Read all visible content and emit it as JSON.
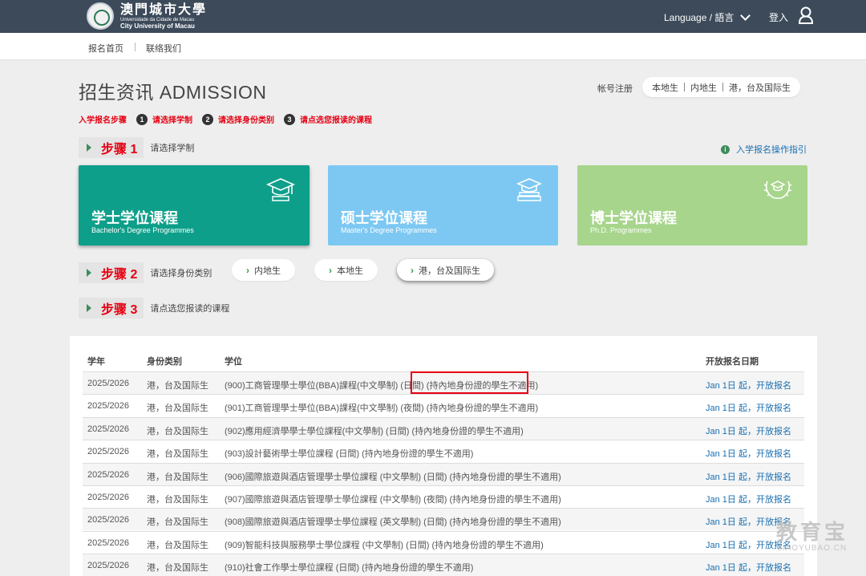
{
  "header": {
    "logo_cn": "澳門城市大學",
    "logo_pt": "Universidade da Cidade de Macau",
    "logo_en": "City University of Macau",
    "language_label": "Language / 語言",
    "login_label": "登入"
  },
  "subnav": {
    "home": "报名首页",
    "contact": "联络我们"
  },
  "page": {
    "title": "招生资讯 ADMISSION",
    "account_register": "帐号注册",
    "register_options": [
      "本地生",
      "内地生",
      "港，台及国际生"
    ]
  },
  "flow": {
    "label": "入学报名步骤",
    "steps": [
      {
        "num": "1",
        "text": "请选择学制"
      },
      {
        "num": "2",
        "text": "请选择身份类别"
      },
      {
        "num": "3",
        "text": "请点选您报读的课程"
      }
    ]
  },
  "step1": {
    "tag": "步骤 1",
    "desc": "请选择学制",
    "guide": "入学报名操作指引"
  },
  "programmes": [
    {
      "cn": "学士学位课程",
      "en": "Bachelor's Degree Programmes",
      "icon": "graduation-cap-icon",
      "color": "#0e9f8a"
    },
    {
      "cn": "硕士学位课程",
      "en": "Master's Degree Programmes",
      "icon": "books-icon",
      "color": "#7dc8f2"
    },
    {
      "cn": "博士学位课程",
      "en": "Ph.D. Programmes",
      "icon": "laurel-cap-icon",
      "color": "#a7d58c"
    }
  ],
  "step2": {
    "tag": "步骤 2",
    "desc": "请选择身份类别",
    "options": [
      "内地生",
      "本地生",
      "港，台及国际生"
    ],
    "selected": "港，台及国际生"
  },
  "step3": {
    "tag": "步骤 3",
    "desc": "请点选您报读的课程"
  },
  "table": {
    "headers": {
      "year": "学年",
      "identity": "身份类别",
      "programme": "学位",
      "date": "开放报名日期"
    },
    "rows": [
      {
        "year": "2025/2026",
        "identity": "港，台及国际生",
        "programme": "(900)工商管理學士學位(BBA)課程(中文學制) (日間) (持內地身份證的學生不適用)",
        "date": "Jan 1日 起，开放报名"
      },
      {
        "year": "2025/2026",
        "identity": "港，台及国际生",
        "programme": "(901)工商管理學士學位(BBA)課程(中文學制) (夜間) (持內地身份證的學生不適用)",
        "date": "Jan 1日 起，开放报名"
      },
      {
        "year": "2025/2026",
        "identity": "港，台及国际生",
        "programme": "(902)應用經濟學學士學位課程(中文學制) (日間) (持內地身份證的學生不適用)",
        "date": "Jan 1日 起，开放报名"
      },
      {
        "year": "2025/2026",
        "identity": "港，台及国际生",
        "programme": "(903)設計藝術學士學位課程 (日間) (持內地身份證的學生不適用)",
        "date": "Jan 1日 起，开放报名"
      },
      {
        "year": "2025/2026",
        "identity": "港，台及国际生",
        "programme": "(906)國際旅遊與酒店管理學士學位課程 (中文學制) (日間) (持內地身份證的學生不適用)",
        "date": "Jan 1日 起，开放报名"
      },
      {
        "year": "2025/2026",
        "identity": "港，台及国际生",
        "programme": "(907)國際旅遊與酒店管理學士學位課程 (中文學制) (夜間) (持內地身份證的學生不適用)",
        "date": "Jan 1日 起，开放报名"
      },
      {
        "year": "2025/2026",
        "identity": "港，台及国际生",
        "programme": "(908)國際旅遊與酒店管理學士學位課程 (英文學制) (日間) (持內地身份證的學生不適用)",
        "date": "Jan 1日 起，开放报名"
      },
      {
        "year": "2025/2026",
        "identity": "港，台及国际生",
        "programme": "(909)智能科技與服務學士學位課程 (中文學制) (日間) (持內地身份證的學生不適用)",
        "date": "Jan 1日 起，开放报名"
      },
      {
        "year": "2025/2026",
        "identity": "港，台及国际生",
        "programme": "(910)社會工作學士學位課程 (日間) (持內地身份證的學生不適用)",
        "date": "Jan 1日 起，开放报名"
      }
    ]
  },
  "watermark": {
    "cn": "教育宝",
    "url": "JIAOYUBAO.CN"
  }
}
